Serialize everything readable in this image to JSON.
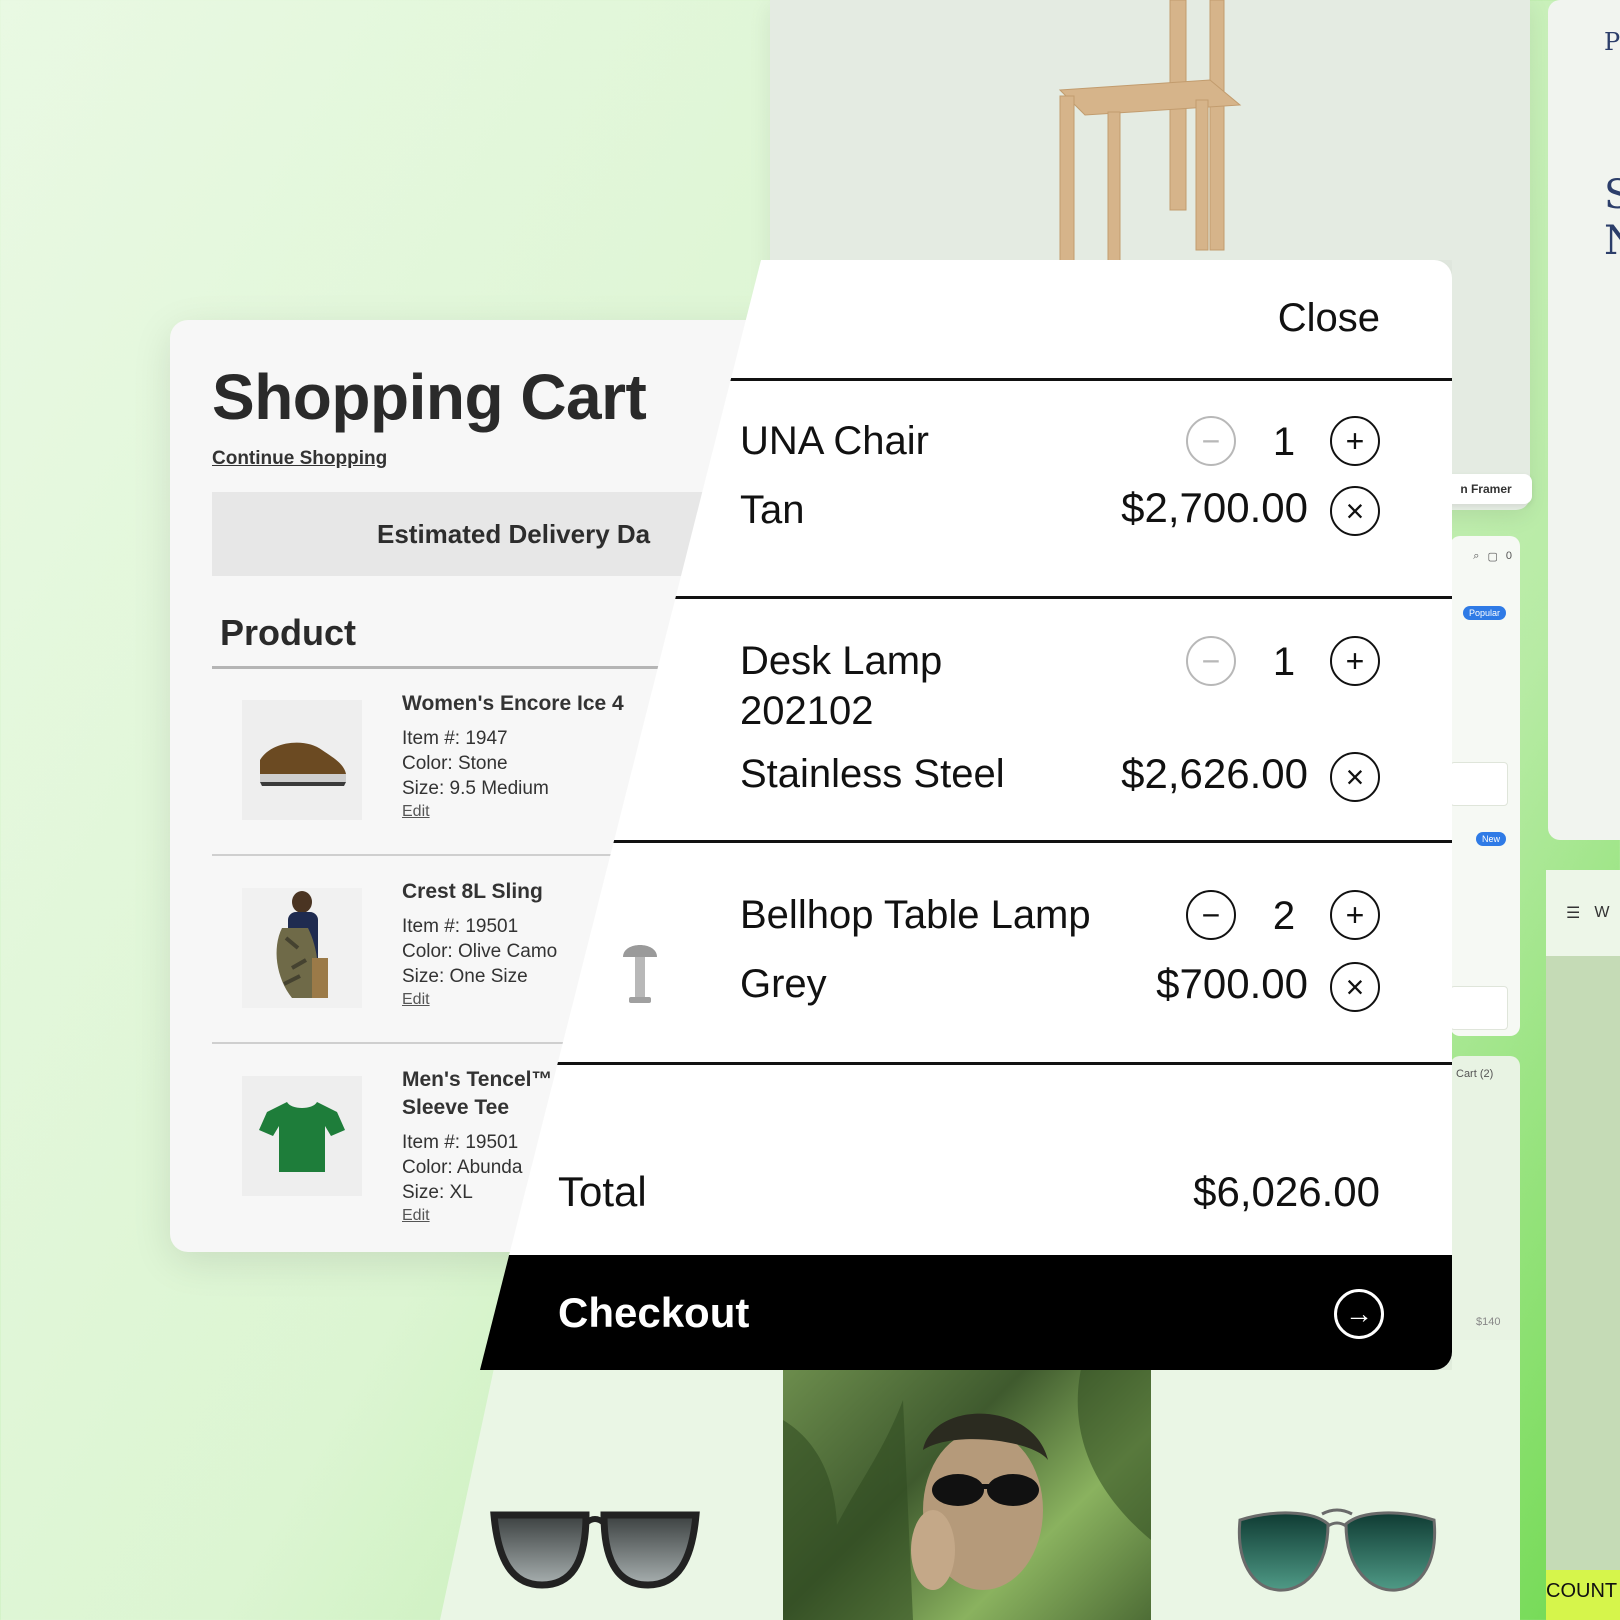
{
  "background_mockups": {
    "framer_badge": "n Framer",
    "edge_letters": [
      "P",
      "S",
      "N"
    ],
    "badges": [
      "Popular",
      "New"
    ],
    "cart_label": "Cart (2)",
    "price_label": "$140",
    "cart_count": "0",
    "partial_menu_letter": "W",
    "discount_text": "COUNT"
  },
  "shopping_cart": {
    "title": "Shopping Cart",
    "continue_link": "Continue Shopping",
    "delivery_banner": "Estimated Delivery Da",
    "product_header": "Product",
    "items": [
      {
        "name": "Women's Encore Ice 4",
        "item_no": "Item #: 1947",
        "color": "Color: Stone",
        "size": "Size: 9.5 Medium",
        "edit": "Edit",
        "thumb_icon": "shoe-icon"
      },
      {
        "name": "Crest 8L Sling",
        "item_no": "Item #: 19501",
        "color": "Color: Olive Camo",
        "size": "Size: One Size",
        "edit": "Edit",
        "thumb_icon": "sling-bag-icon"
      },
      {
        "name": "Men's Tencel™",
        "name_line2": "Sleeve Tee",
        "item_no": "Item #: 19501",
        "color": "Color: Abunda",
        "size": "Size: XL",
        "edit": "Edit",
        "thumb_icon": "tshirt-icon"
      }
    ]
  },
  "cart_drawer": {
    "close_label": "Close",
    "items": [
      {
        "name": "UNA Chair",
        "variant": "Tan",
        "qty": "1",
        "price": "$2,700.00",
        "minus_disabled": true
      },
      {
        "name": "Desk Lamp 202102",
        "variant": "Stainless Steel",
        "qty": "1",
        "price": "$2,626.00",
        "minus_disabled": true
      },
      {
        "name": "Bellhop Table Lamp",
        "variant": "Grey",
        "qty": "2",
        "price": "$700.00",
        "minus_disabled": false
      }
    ],
    "total_label": "Total",
    "total_value": "$6,026.00",
    "checkout_label": "Checkout"
  },
  "colors": {
    "accent_black": "#000000",
    "background_green": "#dcf5d2",
    "discount_yellow": "#d6f54b",
    "badge_blue": "#2f7be6"
  }
}
